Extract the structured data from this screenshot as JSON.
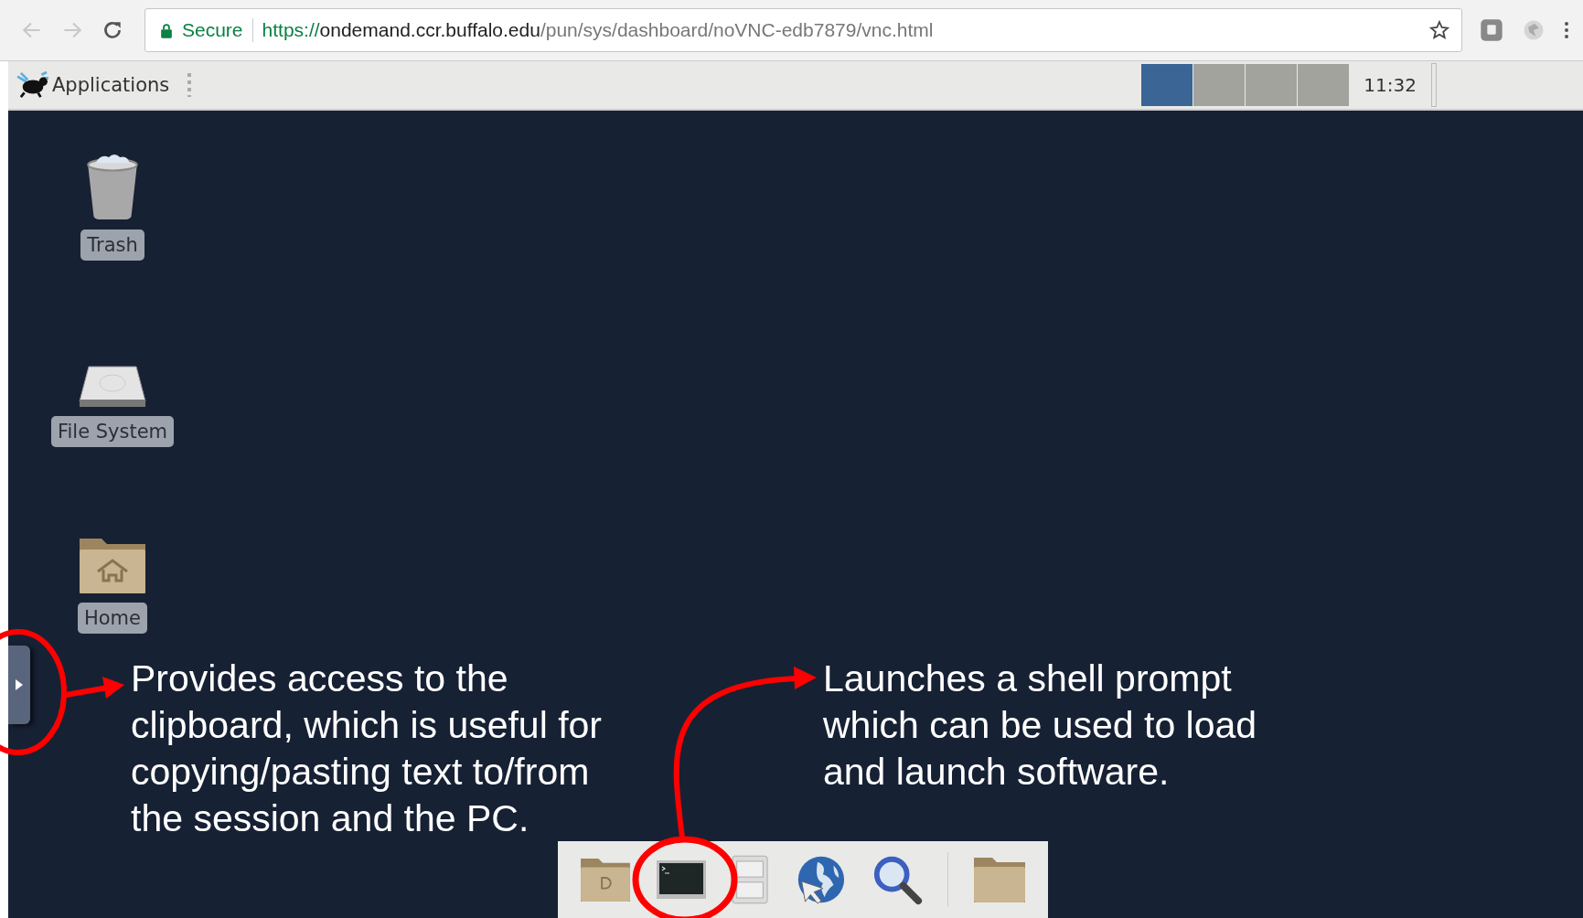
{
  "address_bar": {
    "security_label": "Secure",
    "url_scheme": "https://",
    "url_host": "ondemand.ccr.buffalo.edu",
    "url_path": "/pun/sys/dashboard/noVNC-edb7879/vnc.html"
  },
  "panel": {
    "menu_label": "Applications",
    "workspaces": [
      {
        "selected": true
      },
      {
        "selected": false
      },
      {
        "selected": false
      },
      {
        "selected": false
      }
    ],
    "clock": "11:32"
  },
  "desktop_icons": [
    {
      "kind": "trash",
      "label": "Trash"
    },
    {
      "kind": "drive",
      "label": "File System"
    },
    {
      "kind": "home",
      "label": "Home"
    }
  ],
  "dock": {
    "items": [
      {
        "kind": "documents"
      },
      {
        "kind": "terminal"
      },
      {
        "kind": "cabinet"
      },
      {
        "kind": "browser"
      },
      {
        "kind": "search"
      },
      {
        "kind": "separator"
      },
      {
        "kind": "folder"
      }
    ]
  },
  "annotations": [
    {
      "kind": "clipboard",
      "text": "Provides access to the\nclipboard, which is useful for\ncopying/pasting text to/from\nthe session and the PC."
    },
    {
      "kind": "terminal",
      "text": "Launches a shell prompt\nwhich can be used to load\nand launch software."
    }
  ]
}
